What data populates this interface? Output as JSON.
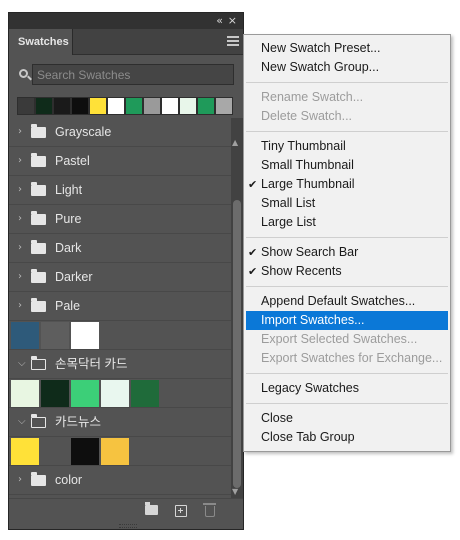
{
  "panel": {
    "tab_title": "Swatches",
    "collapse_glyph": "«",
    "close_glyph": "×",
    "search_placeholder": "Search Swatches",
    "recent_colors": [
      "#3a3a3a",
      "#0f2b1a",
      "#1a1a1a",
      "#0e0e0e",
      "#ffe138",
      "#ffffff",
      "#1f9a5a",
      "#9a9a9a",
      "#ffffff",
      "#e8f6ea",
      "#1f9a5a",
      "#a8a8a8"
    ],
    "groups": [
      {
        "label": "Grayscale",
        "expanded": false,
        "swatches": []
      },
      {
        "label": "Pastel",
        "expanded": false,
        "swatches": []
      },
      {
        "label": "Light",
        "expanded": false,
        "swatches": []
      },
      {
        "label": "Pure",
        "expanded": false,
        "swatches": []
      },
      {
        "label": "Dark",
        "expanded": false,
        "swatches": []
      },
      {
        "label": "Darker",
        "expanded": false,
        "swatches": []
      },
      {
        "label": "Pale",
        "expanded": false,
        "swatches": []
      },
      {
        "label": "",
        "expanded": null,
        "swatches": [
          "#2e5a7a",
          "#5e5e5e",
          "#ffffff"
        ]
      },
      {
        "label": "손목닥터 카드",
        "expanded": true,
        "swatches": [
          "#e8f6e2",
          "#0f2b1a",
          "#3ccf78",
          "#e9f7ef",
          "#1f6b3a"
        ]
      },
      {
        "label": "카드뉴스",
        "expanded": true,
        "swatches": [
          "#ffe138",
          "",
          "#0e0e0e",
          "#f6c340"
        ]
      },
      {
        "label": "color",
        "expanded": false,
        "swatches": []
      }
    ]
  },
  "menu": {
    "items": [
      {
        "label": "New Swatch Preset...",
        "enabled": true,
        "checked": false,
        "sep_after": false
      },
      {
        "label": "New Swatch Group...",
        "enabled": true,
        "checked": false,
        "sep_after": true
      },
      {
        "label": "Rename Swatch...",
        "enabled": false,
        "checked": false,
        "sep_after": false
      },
      {
        "label": "Delete Swatch...",
        "enabled": false,
        "checked": false,
        "sep_after": true
      },
      {
        "label": "Tiny Thumbnail",
        "enabled": true,
        "checked": false,
        "sep_after": false
      },
      {
        "label": "Small Thumbnail",
        "enabled": true,
        "checked": false,
        "sep_after": false
      },
      {
        "label": "Large Thumbnail",
        "enabled": true,
        "checked": true,
        "sep_after": false
      },
      {
        "label": "Small List",
        "enabled": true,
        "checked": false,
        "sep_after": false
      },
      {
        "label": "Large List",
        "enabled": true,
        "checked": false,
        "sep_after": true
      },
      {
        "label": "Show Search Bar",
        "enabled": true,
        "checked": true,
        "sep_after": false
      },
      {
        "label": "Show Recents",
        "enabled": true,
        "checked": true,
        "sep_after": true
      },
      {
        "label": "Append Default Swatches...",
        "enabled": true,
        "checked": false,
        "sep_after": false
      },
      {
        "label": "Import Swatches...",
        "enabled": true,
        "checked": false,
        "highlighted": true,
        "sep_after": false
      },
      {
        "label": "Export Selected Swatches...",
        "enabled": false,
        "checked": false,
        "sep_after": false
      },
      {
        "label": "Export Swatches for Exchange...",
        "enabled": false,
        "checked": false,
        "sep_after": true
      },
      {
        "label": "Legacy Swatches",
        "enabled": true,
        "checked": false,
        "sep_after": true
      },
      {
        "label": "Close",
        "enabled": true,
        "checked": false,
        "sep_after": false
      },
      {
        "label": "Close Tab Group",
        "enabled": true,
        "checked": false,
        "sep_after": false
      }
    ],
    "check_glyph": "✔",
    "highlight_color": "#0b78d7"
  }
}
